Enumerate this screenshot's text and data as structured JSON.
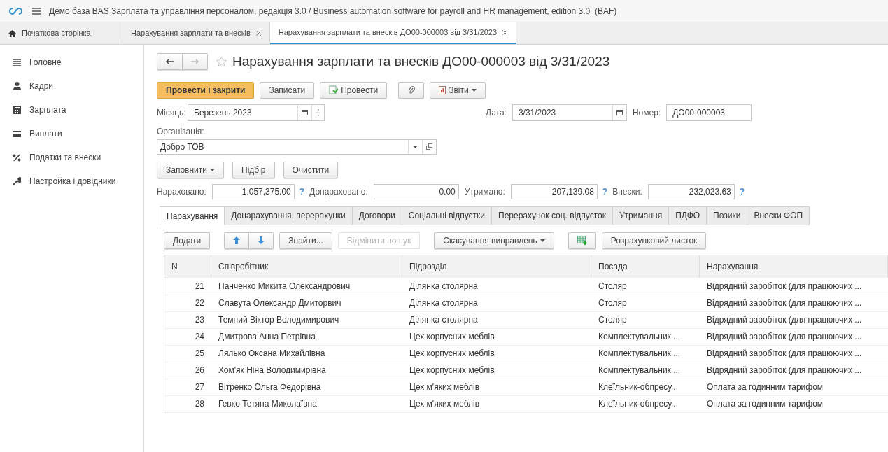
{
  "window": {
    "title": "Демо база BAS Зарплата та управління персоналом, редакція 3.0 / Business automation software for payroll and HR management, edition 3.0  (BAF)"
  },
  "open_tabs": [
    {
      "label": "Початкова сторінка",
      "kind": "home",
      "selected": false
    },
    {
      "label": "Нарахування зарплати та внесків",
      "kind": "doc",
      "selected": false
    },
    {
      "label": "Нарахування зарплати та внесків ДО00-000003 від 3/31/2023",
      "kind": "doc",
      "selected": true
    }
  ],
  "sidebar": {
    "items": [
      {
        "label": "Головне",
        "kind": "main"
      },
      {
        "label": "Кадри",
        "kind": "staff"
      },
      {
        "label": "Зарплата",
        "kind": "salary"
      },
      {
        "label": "Виплати",
        "kind": "payments"
      },
      {
        "label": "Податки та внески",
        "kind": "taxes"
      },
      {
        "label": "Настройка і довідники",
        "kind": "settings"
      }
    ]
  },
  "document": {
    "title": "Нарахування зарплати та внесків ДО00-000003 від 3/31/2023",
    "toolbar": [
      {
        "label": "Провести і закрити",
        "kind": "primary"
      },
      {
        "label": "Записати",
        "kind": "plain"
      },
      {
        "label": "Провести",
        "kind": "post"
      },
      {
        "kind": "clip"
      },
      {
        "label": "Звіти",
        "kind": "reports"
      }
    ],
    "month": {
      "label": "Місяць:",
      "value": "Березень 2023"
    },
    "date": {
      "label": "Дата:",
      "value": "3/31/2023"
    },
    "number": {
      "label": "Номер:",
      "value": "ДО00-000003"
    },
    "organization": {
      "label": "Організація:",
      "value": "Добро ТОВ"
    },
    "fill_buttons": [
      {
        "label": "Заповнити",
        "kind": "dropdown"
      },
      {
        "label": "Підбір",
        "kind": "plain"
      },
      {
        "label": "Очистити",
        "kind": "plain"
      }
    ],
    "totals": [
      {
        "label": "Нараховано:",
        "value": "1,057,375.00",
        "help": "?"
      },
      {
        "label": "Донараховано:",
        "value": "0.00"
      },
      {
        "label": "Утримано:",
        "value": "207,139.08",
        "help": "?"
      },
      {
        "label": "Внески:",
        "value": "232,023.63",
        "help": "?"
      }
    ],
    "tabs": [
      {
        "label": "Нарахування",
        "selected": true
      },
      {
        "label": "Донарахування, перерахунки",
        "selected": false
      },
      {
        "label": "Договори",
        "selected": false
      },
      {
        "label": "Соціальні відпустки",
        "selected": false
      },
      {
        "label": "Перерахунок соц. відпусток",
        "selected": false
      },
      {
        "label": "Утримання",
        "selected": false
      },
      {
        "label": "ПДФО",
        "selected": false
      },
      {
        "label": "Позики",
        "selected": false
      },
      {
        "label": "Внески ФОП",
        "selected": false
      }
    ],
    "table_toolbar": [
      {
        "label": "Додати",
        "kind": "plain",
        "disabled": false
      },
      {
        "kind": "arrows",
        "disabled": false
      },
      {
        "label": "Знайти...",
        "kind": "plain",
        "disabled": false
      },
      {
        "label": "Відмінити пошук",
        "kind": "plain",
        "disabled": true
      },
      {
        "label": "Скасування виправлень",
        "kind": "dropdown",
        "disabled": false
      },
      {
        "kind": "grid",
        "disabled": false
      },
      {
        "label": "Розрахунковий листок",
        "kind": "plain",
        "disabled": false
      }
    ],
    "table": {
      "columns": [
        "N",
        "Співробітник",
        "Підрозділ",
        "Посада",
        "Нарахування"
      ],
      "rows": [
        [
          "21",
          "Панченко Микита Олександрович",
          "Ділянка столярна",
          "Столяр",
          "Відрядний заробіток (для працюючих ..."
        ],
        [
          "22",
          "Славута Олександр Дмиторвич",
          "Ділянка столярна",
          "Столяр",
          "Відрядний заробіток (для працюючих ..."
        ],
        [
          "23",
          "Темний Віктор Володимирович",
          "Ділянка столярна",
          "Столяр",
          "Відрядний заробіток (для працюючих ..."
        ],
        [
          "24",
          "Дмитрова Анна Петрівна",
          "Цех корпусних меблів",
          "Комплектувальник ...",
          "Відрядний заробіток (для працюючих ..."
        ],
        [
          "25",
          "Лялько Оксана Михайлівна",
          "Цех корпусних меблів",
          "Комплектувальник ...",
          "Відрядний заробіток (для працюючих ..."
        ],
        [
          "26",
          "Хом'як Ніна Володимирівна",
          "Цех корпусних меблів",
          "Комплектувальник ...",
          "Відрядний заробіток (для працюючих ..."
        ],
        [
          "27",
          "Вітренко Ольга Федорівна",
          "Цех м'яких меблів",
          "Клеїльник-обпресу...",
          "Оплата за годинним тарифом"
        ],
        [
          "28",
          "Гевко Тетяна Миколаївна",
          "Цех м'яких меблів",
          "Клеїльник-обпресу...",
          "Оплата за годинним тарифом"
        ]
      ]
    }
  }
}
